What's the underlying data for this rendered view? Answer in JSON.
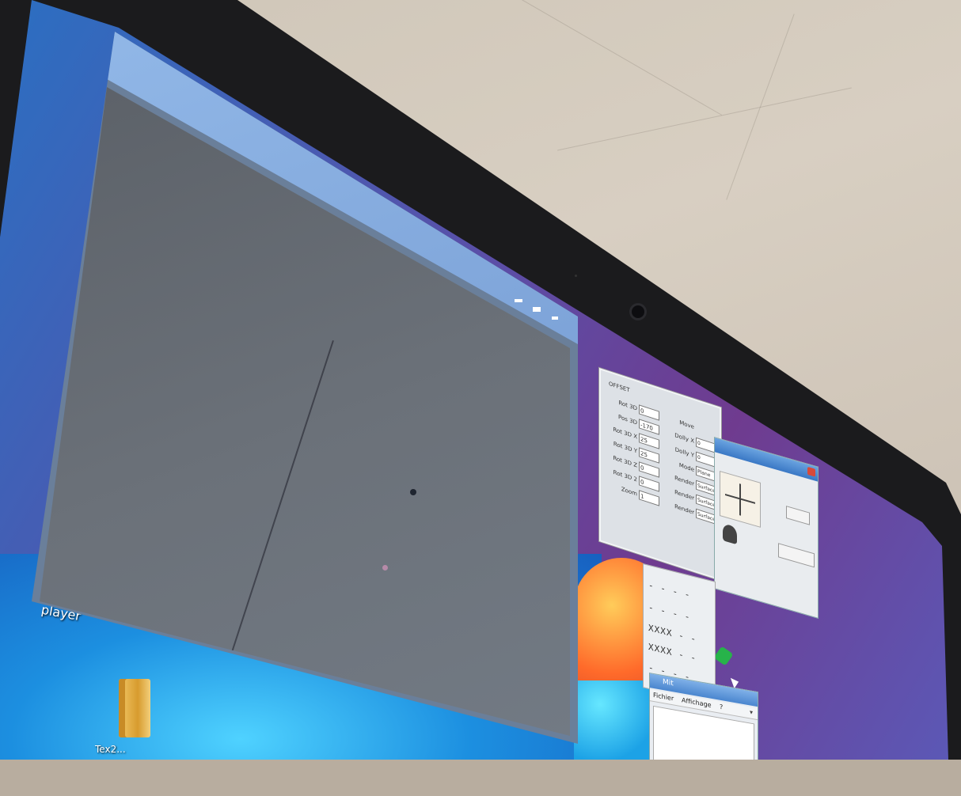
{
  "main_window": {
    "title": "",
    "controls": [
      "minimize",
      "maximize",
      "close"
    ]
  },
  "desktop": {
    "label_player": "player",
    "label_top": "",
    "folder_caption": "Tex2...",
    "folder_icon": "folder-icon"
  },
  "param_panel": {
    "title": "OFFSET",
    "left_rows": [
      {
        "label": "Rot 3D",
        "value": "0"
      },
      {
        "label": "Pos 3D",
        "value": "-170"
      },
      {
        "label": "Rot 3D X",
        "value": "25"
      },
      {
        "label": "Rot 3D Y",
        "value": "25"
      },
      {
        "label": "Rot 3D Z",
        "value": "0"
      },
      {
        "label": "Rot 3D 2",
        "value": "0"
      },
      {
        "label": "Zoom",
        "value": "1"
      }
    ],
    "right_rows": [
      {
        "label": "Move",
        "value": ""
      },
      {
        "label": "Dolly X",
        "value": "0"
      },
      {
        "label": "Dolly Y",
        "value": "0"
      },
      {
        "label": "Mode",
        "value": "Plane"
      },
      {
        "label": "Render",
        "value": "Surface"
      },
      {
        "label": "Render",
        "value": "Surface"
      },
      {
        "label": "Render",
        "value": "Surface"
      }
    ]
  },
  "graph_window": {
    "lines": [
      "- - - -",
      "- - - -",
      "XXXX - -",
      "XXXX - -",
      "- - - -"
    ]
  },
  "bottom_window": {
    "title": "Mit",
    "menu": [
      "Fichier",
      "Affichage",
      "?"
    ]
  },
  "colors": {
    "wallpaper_blue": "#1c8fe0",
    "wallpaper_purple": "#6f3b8f",
    "canvas_gray": "#6b7179",
    "titlebar_blue": "#6aa3e0"
  }
}
